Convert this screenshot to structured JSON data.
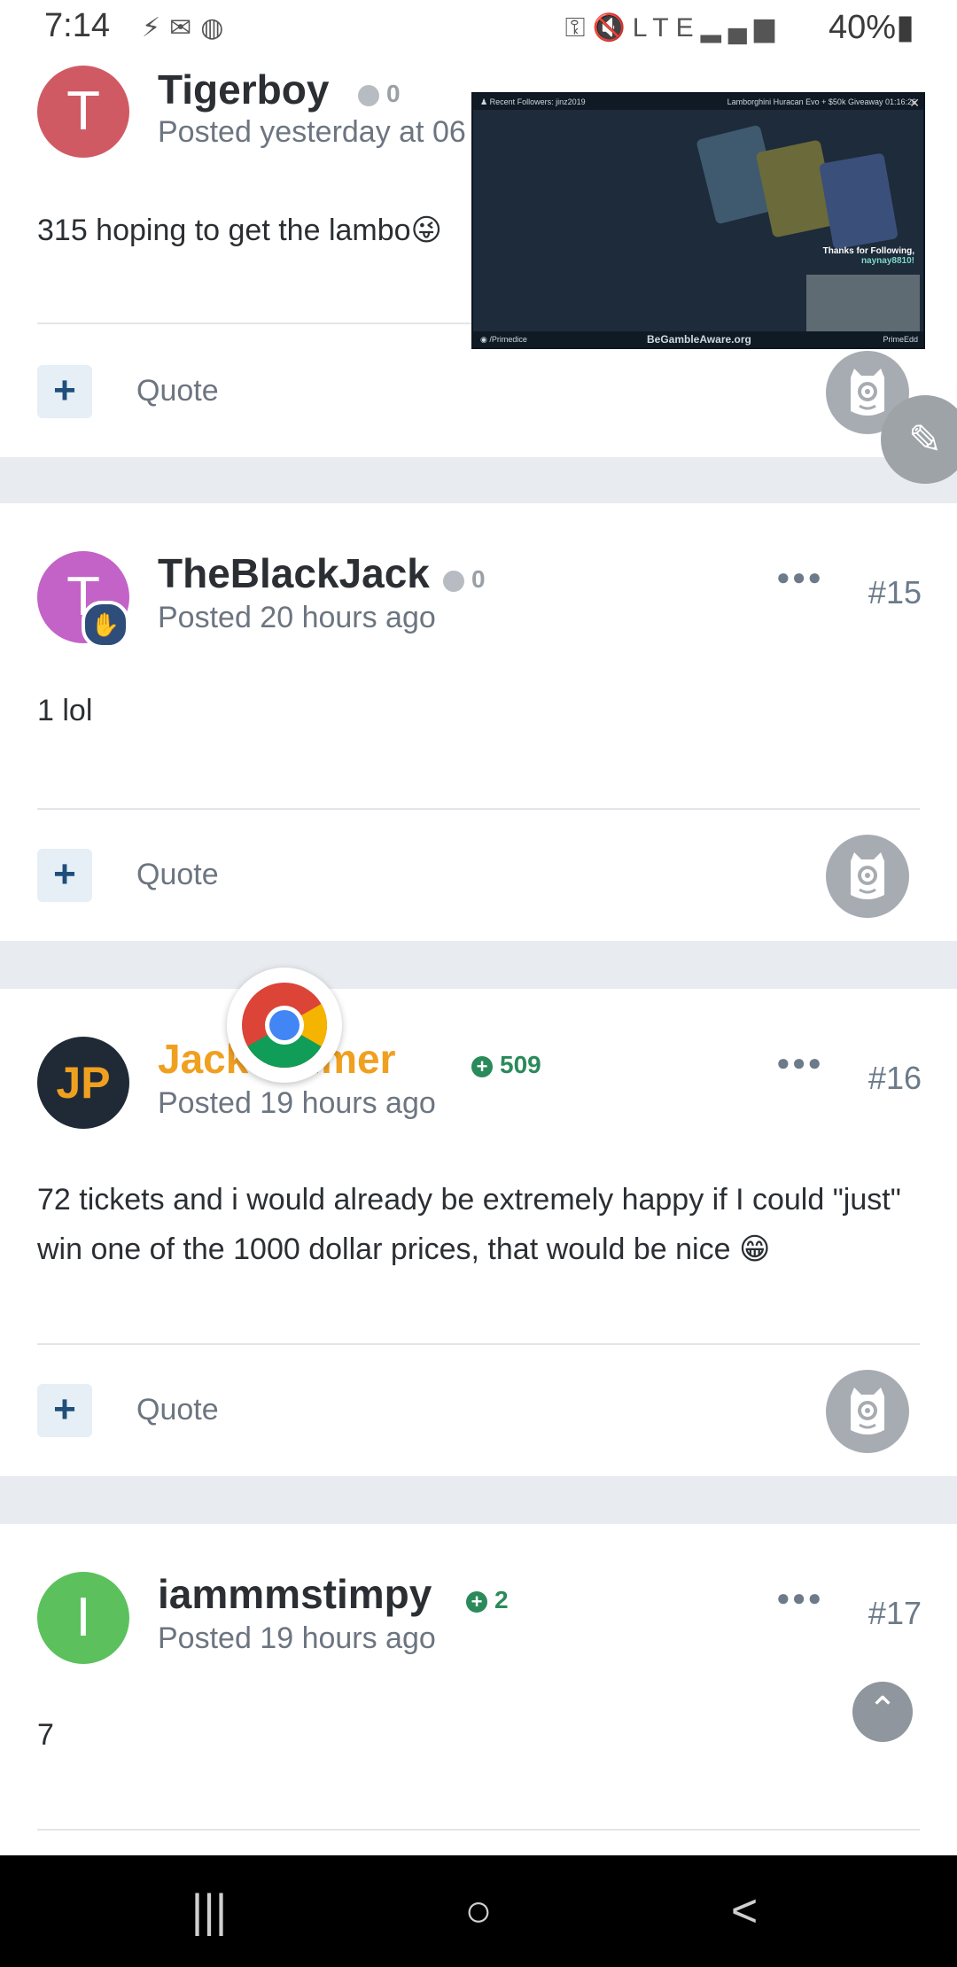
{
  "status_bar": {
    "time": "7:14",
    "battery": "40%",
    "left_icons": [
      "notification-icon",
      "mail-icon",
      "app-icon"
    ],
    "right_icons": [
      "key-icon",
      "mute-icon",
      "volte-icon",
      "lte-icon",
      "signal-icon",
      "battery-icon"
    ],
    "network_label": "LTE"
  },
  "posts": [
    {
      "avatar_letter": "T",
      "avatar_color": "#d05a64",
      "username": "Tigerboy",
      "reputation": "0",
      "posted": "Posted yesterday at 06",
      "body": "315 hoping to get the lambo😜",
      "quote_label": "Quote"
    },
    {
      "avatar_letter": "T",
      "avatar_color": "#c362c7",
      "username": "TheBlackJack",
      "reputation": "0",
      "posted": "Posted 20 hours ago",
      "post_number": "#15",
      "body": "1 lol",
      "quote_label": "Quote"
    },
    {
      "avatar_letter": "JP",
      "avatar_color": "#1f2a36",
      "username": "JackS almer",
      "username_color": "#f0a020",
      "reputation": "509",
      "posted": "Posted 19 hours ago",
      "post_number": "#16",
      "body": "72 tickets and i would already be extremely happy if I could \"just\" win one of the 1000 dollar prices, that would be nice 😁",
      "quote_label": "Quote"
    },
    {
      "avatar_letter": "I",
      "avatar_color": "#5cc15c",
      "username": "iammmstimpy",
      "reputation": "2",
      "posted": "Posted 19 hours ago",
      "post_number": "#17",
      "body": "7"
    }
  ],
  "video_overlay": {
    "top_left": "♟ Recent Followers: jinz2019",
    "top_right": "Lamborghini Huracan Evo + $50k Giveaway 01:16:26",
    "thanks_line1": "Thanks for Following,",
    "thanks_line2": "naynay8810!",
    "footer_left": "◉ /Primedice",
    "footer_center": "BeGambleAware.org",
    "footer_right": "PrimeEdd"
  },
  "nav_bar": {
    "recents_icon": "|||",
    "home_icon": "○",
    "back_icon": "<"
  }
}
